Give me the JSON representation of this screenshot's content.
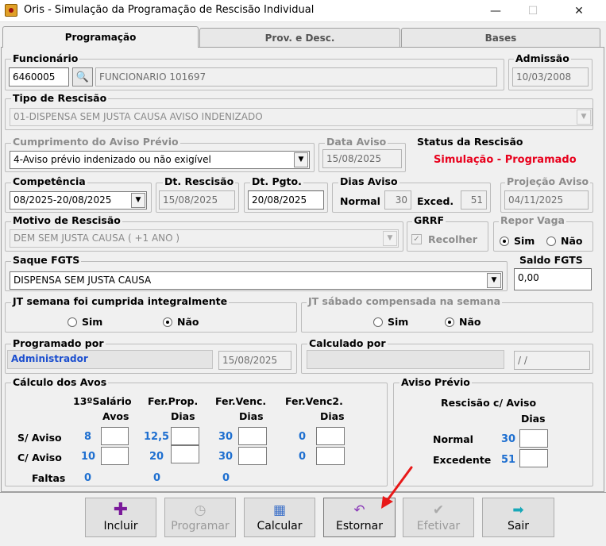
{
  "window": {
    "title": "Oris - Simulação da Programação de Rescisão Individual",
    "minimize": "—",
    "maximize": "☐",
    "close": "✕"
  },
  "tabs": [
    {
      "label": "Programação"
    },
    {
      "label": "Prov. e Desc."
    },
    {
      "label": "Bases"
    }
  ],
  "funcionario": {
    "label": "Funcionário",
    "codigo": "6460005",
    "nome": "FUNCIONARIO 101697"
  },
  "admissao": {
    "label": "Admissão",
    "value": "10/03/2008"
  },
  "tipo_rescisao": {
    "label": "Tipo de Rescisão",
    "value": "01-DISPENSA SEM JUSTA CAUSA AVISO INDENIZADO"
  },
  "cumprimento": {
    "label": "Cumprimento do Aviso Prévio",
    "value": "4-Aviso prévio indenizado ou não exigível"
  },
  "data_aviso": {
    "label": "Data Aviso",
    "value": "15/08/2025"
  },
  "status": {
    "label": "Status da Rescisão",
    "value": "Simulação - Programado"
  },
  "competencia": {
    "label": "Competência",
    "value": "08/2025-20/08/2025"
  },
  "dt_rescisao": {
    "label": "Dt. Rescisão",
    "value": "15/08/2025"
  },
  "dt_pgto": {
    "label": "Dt. Pgto.",
    "value": "20/08/2025"
  },
  "dias_aviso": {
    "label": "Dias Aviso",
    "normal_label": "Normal",
    "normal_value": "30",
    "exced_label": "Exced.",
    "exced_value": "51"
  },
  "projecao": {
    "label": "Projeção Aviso",
    "value": "04/11/2025"
  },
  "motivo": {
    "label": "Motivo de Rescisão",
    "value": "DEM SEM JUSTA CAUSA ( +1 ANO )"
  },
  "grrf": {
    "label": "GRRF",
    "check_label": "Recolher"
  },
  "repor_vaga": {
    "label": "Repor Vaga",
    "sim": "Sim",
    "nao": "Não"
  },
  "saque": {
    "label": "Saque FGTS",
    "value": "DISPENSA SEM JUSTA CAUSA"
  },
  "saldo": {
    "label": "Saldo FGTS",
    "value": "0,00"
  },
  "jt_semana": {
    "label": "JT semana foi cumprida integralmente",
    "sim": "Sim",
    "nao": "Não"
  },
  "jt_sabado": {
    "label": "JT sábado compensada na semana",
    "sim": "Sim",
    "nao": "Não"
  },
  "programado": {
    "label": "Programado por",
    "user": "Administrador",
    "date": "15/08/2025"
  },
  "calculado": {
    "label": "Calculado por",
    "date": " / /"
  },
  "calculo": {
    "label": "Cálculo dos Avos",
    "headers": [
      {
        "l1": "13ºSalário",
        "l2": "Avos"
      },
      {
        "l1": "Fer.Prop.",
        "l2": "Dias"
      },
      {
        "l1": "Fer.Venc.",
        "l2": "Dias"
      },
      {
        "l1": "Fer.Venc2.",
        "l2": "Dias"
      }
    ],
    "rows": [
      {
        "label": "S/ Aviso",
        "values": [
          "8",
          "12,5",
          "30",
          "0"
        ]
      },
      {
        "label": "C/ Aviso",
        "values": [
          "10",
          "20",
          "30",
          "0"
        ]
      },
      {
        "label": "Faltas",
        "values": [
          "0",
          "0",
          "0"
        ]
      }
    ]
  },
  "aviso": {
    "label": "Aviso Prévio",
    "h1": "Rescisão c/ Aviso",
    "h2": "Dias",
    "normal_label": "Normal",
    "normal_value": "30",
    "exced_label": "Excedente",
    "exced_value": "51"
  },
  "buttons": {
    "incluir": "Incluir",
    "programar": "Programar",
    "calcular": "Calcular",
    "estornar": "Estornar",
    "efetivar": "Efetivar",
    "sair": "Sair"
  }
}
